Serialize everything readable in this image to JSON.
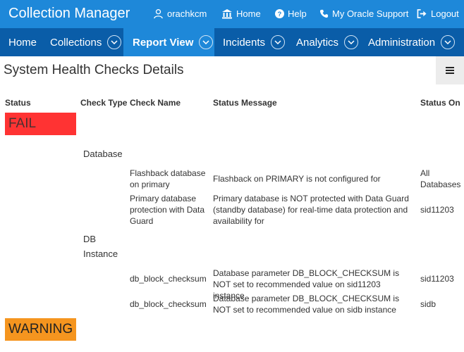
{
  "header": {
    "app_title": "Collection Manager",
    "user": "orachkcm",
    "home": "Home",
    "help": "Help",
    "support": "My Oracle Support",
    "logout": "Logout"
  },
  "nav": {
    "home": "Home",
    "collections": "Collections",
    "report_view": "Report View",
    "incidents": "Incidents",
    "analytics": "Analytics",
    "administration": "Administration"
  },
  "region": {
    "title": "System Health Checks Details"
  },
  "columns": {
    "status": "Status",
    "check_type": "Check Type",
    "check_name": "Check Name",
    "status_message": "Status Message",
    "status_on": "Status On"
  },
  "groups": {
    "fail": {
      "label": "FAIL",
      "database": {
        "type": "Database",
        "rows": [
          {
            "name": "Flashback database on primary",
            "message": "Flashback on PRIMARY is not configured for",
            "on": "All Databases"
          },
          {
            "name": "Primary database protection with Data Guard",
            "message": "Primary database is NOT protected with Data Guard (standby database) for real-time data protection and availability for",
            "on": "sid11203"
          }
        ]
      },
      "instance": {
        "type_line1": "DB",
        "type_line2": "Instance",
        "rows": [
          {
            "name": "db_block_checksum",
            "message": "Database parameter DB_BLOCK_CHECKSUM is NOT set to recommended value on sid11203 instance",
            "on": "sid11203"
          },
          {
            "name": "db_block_checksum",
            "message": "Database parameter DB_BLOCK_CHECKSUM is NOT set to recommended value on sidb instance",
            "on": "sidb"
          }
        ]
      }
    },
    "warning": {
      "label": "WARNING"
    }
  },
  "colors": {
    "topbar": "#1e88d9",
    "navbar": "#0a5da8",
    "fail": "#ff3333",
    "warning": "#f5951f"
  },
  "icons": [
    "user-icon",
    "home-icon",
    "help-icon",
    "phone-icon",
    "logout-icon",
    "chevron-down-icon",
    "hamburger-menu-icon"
  ]
}
